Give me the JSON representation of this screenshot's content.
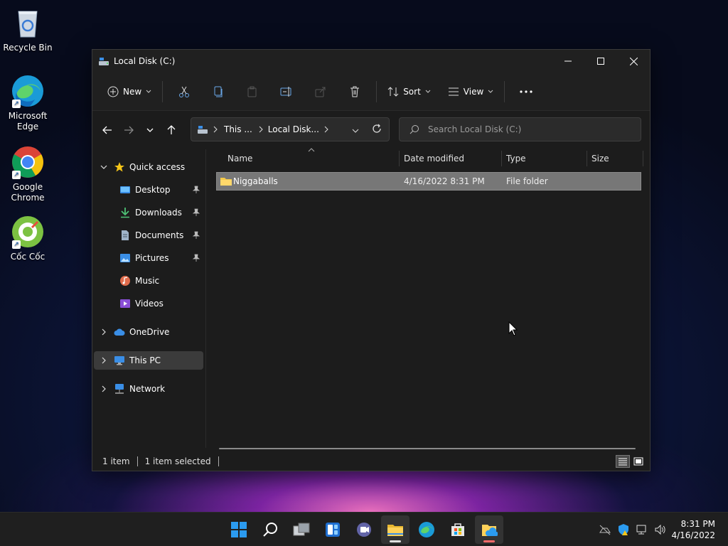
{
  "desktop": {
    "icons": [
      {
        "label": "Recycle Bin"
      },
      {
        "label": "Microsoft Edge"
      },
      {
        "label": "Google Chrome"
      },
      {
        "label": "Cốc Cốc"
      }
    ]
  },
  "window": {
    "title": "Local Disk (C:)",
    "commands": {
      "new_label": "New",
      "sort_label": "Sort",
      "view_label": "View"
    },
    "address": {
      "crumb1": "This ...",
      "crumb2": "Local Disk..."
    },
    "search": {
      "placeholder": "Search Local Disk (C:)"
    },
    "sidebar": {
      "quick_access": "Quick access",
      "items": [
        {
          "label": "Desktop"
        },
        {
          "label": "Downloads"
        },
        {
          "label": "Documents"
        },
        {
          "label": "Pictures"
        },
        {
          "label": "Music"
        },
        {
          "label": "Videos"
        }
      ],
      "onedrive": "OneDrive",
      "this_pc": "This PC",
      "network": "Network"
    },
    "columns": {
      "name": "Name",
      "date": "Date modified",
      "type": "Type",
      "size": "Size"
    },
    "files": [
      {
        "name": "Niggaballs",
        "date": "4/16/2022 8:31 PM",
        "type": "File folder",
        "size": ""
      }
    ],
    "status": {
      "count": "1 item",
      "selected": "1 item selected"
    }
  },
  "taskbar": {
    "time": "8:31 PM",
    "date": "4/16/2022"
  },
  "colors": {
    "accent": "#0078d4",
    "folder": "#f3c94a",
    "window_bg": "#1c1c1c",
    "selection": "#777777"
  }
}
